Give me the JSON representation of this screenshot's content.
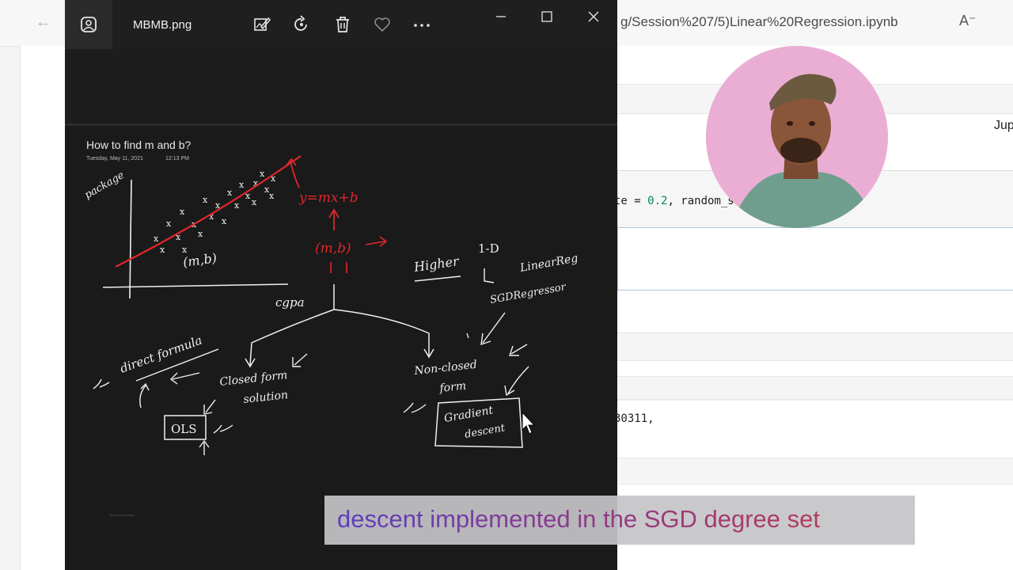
{
  "browser": {
    "url": "g/Session%207/5)Linear%20Regression.ipynb",
    "jupyter_label": "Jup",
    "code_prefix": "te = ",
    "code_number": "0.2",
    "code_suffix": ", random_state",
    "output_text": "30311,"
  },
  "photos": {
    "file_name": "MBMB.png",
    "toolbar_icons": [
      "edit-image-icon",
      "rotate-icon",
      "delete-icon",
      "favorite-icon",
      "more-icon"
    ],
    "window_controls": [
      "minimize-icon",
      "maximize-icon",
      "close-icon"
    ]
  },
  "note": {
    "title": "How to find m and b?",
    "date": "Tuesday, May 11, 2021",
    "time": "12:13 PM",
    "handwriting": {
      "ylabel": "package",
      "xlabel": "cgpa",
      "equation": "y=mx+b",
      "params_red": "(m,b)",
      "params_white": "(m,b)",
      "higher": "Higher",
      "one_d": "1-D",
      "linear_reg": "LinearReg",
      "sgd_reg": "SGDRegressor",
      "direct_formula": "direct formula",
      "closed_form": "Closed form",
      "solution": "solution",
      "ols": "OLS",
      "non_closed": "Non-closed",
      "form": "form",
      "gradient": "Gradient",
      "descent": "descent"
    }
  },
  "caption": {
    "text": "descent implemented in the SGD degree set"
  },
  "colors": {
    "viewer_bg": "#1f1f1f",
    "ink_red": "#e0262b",
    "ink_white": "#f2f2f2",
    "avatar_bg": "#eaaed4"
  }
}
